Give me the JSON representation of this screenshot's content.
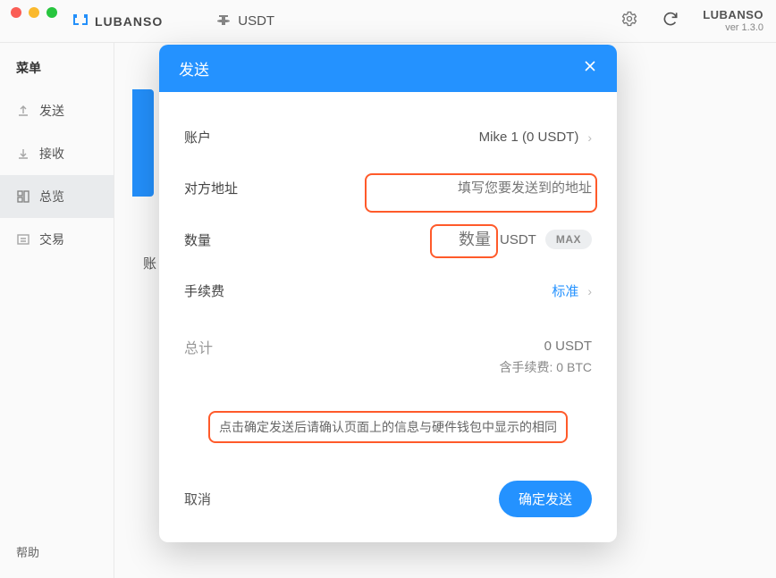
{
  "brand": {
    "name": "LUBANSO",
    "ver_name": "LUBANSO",
    "version": "ver 1.3.0"
  },
  "top": {
    "coin": "USDT"
  },
  "sidebar": {
    "title": "菜单",
    "items": [
      {
        "label": "发送"
      },
      {
        "label": "接收"
      },
      {
        "label": "总览"
      },
      {
        "label": "交易"
      }
    ],
    "help": "帮助"
  },
  "content": {
    "account_hint": "账"
  },
  "modal": {
    "title": "发送",
    "rows": {
      "account": {
        "label": "账户",
        "value": "Mike 1 (0 USDT)"
      },
      "address": {
        "label": "对方地址",
        "placeholder": "填写您要发送到的地址"
      },
      "quantity": {
        "label": "数量",
        "placeholder": "数量",
        "unit": "USDT",
        "max": "MAX"
      },
      "fee": {
        "label": "手续费",
        "value": "标准"
      },
      "total": {
        "label": "总计",
        "value": "0 USDT",
        "fee_text": "含手续费: 0 BTC"
      }
    },
    "note": "点击确定发送后请确认页面上的信息与硬件钱包中显示的相同",
    "cancel": "取消",
    "confirm": "确定发送"
  }
}
